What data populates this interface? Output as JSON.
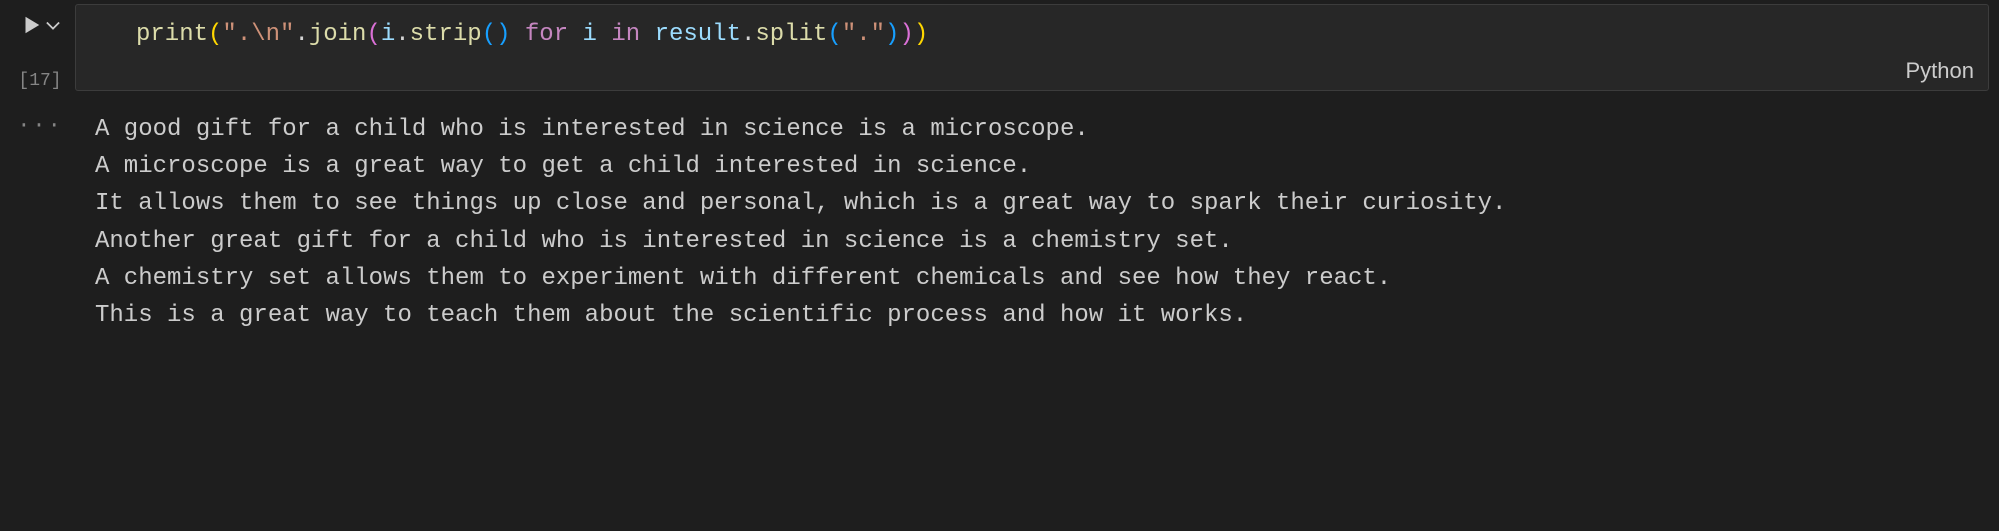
{
  "cell": {
    "execution_count_label": "[17]",
    "language_label": "Python",
    "run_tooltip": "Run Cell",
    "code_tokens": [
      {
        "t": "fn",
        "v": "print"
      },
      {
        "t": "brk1",
        "v": "("
      },
      {
        "t": "str",
        "v": "\".\\n\""
      },
      {
        "t": "pun",
        "v": "."
      },
      {
        "t": "fn",
        "v": "join"
      },
      {
        "t": "brk2",
        "v": "("
      },
      {
        "t": "var",
        "v": "i"
      },
      {
        "t": "pun",
        "v": "."
      },
      {
        "t": "fn",
        "v": "strip"
      },
      {
        "t": "brk3",
        "v": "("
      },
      {
        "t": "brk3",
        "v": ")"
      },
      {
        "t": "pun",
        "v": " "
      },
      {
        "t": "kw",
        "v": "for"
      },
      {
        "t": "pun",
        "v": " "
      },
      {
        "t": "var",
        "v": "i"
      },
      {
        "t": "pun",
        "v": " "
      },
      {
        "t": "kw",
        "v": "in"
      },
      {
        "t": "pun",
        "v": " "
      },
      {
        "t": "var",
        "v": "result"
      },
      {
        "t": "pun",
        "v": "."
      },
      {
        "t": "fn",
        "v": "split"
      },
      {
        "t": "brk3",
        "v": "("
      },
      {
        "t": "str",
        "v": "\".\""
      },
      {
        "t": "brk3",
        "v": ")"
      },
      {
        "t": "brk2",
        "v": ")"
      },
      {
        "t": "brk1",
        "v": ")"
      }
    ]
  },
  "output": {
    "ellipsis_label": "···",
    "lines": [
      "A good gift for a child who is interested in science is a microscope.",
      "A microscope is a great way to get a child interested in science.",
      "It allows them to see things up close and personal, which is a great way to spark their curiosity.",
      "Another great gift for a child who is interested in science is a chemistry set.",
      "A chemistry set allows them to experiment with different chemicals and see how they react.",
      "This is a great way to teach them about the scientific process and how it works."
    ]
  }
}
